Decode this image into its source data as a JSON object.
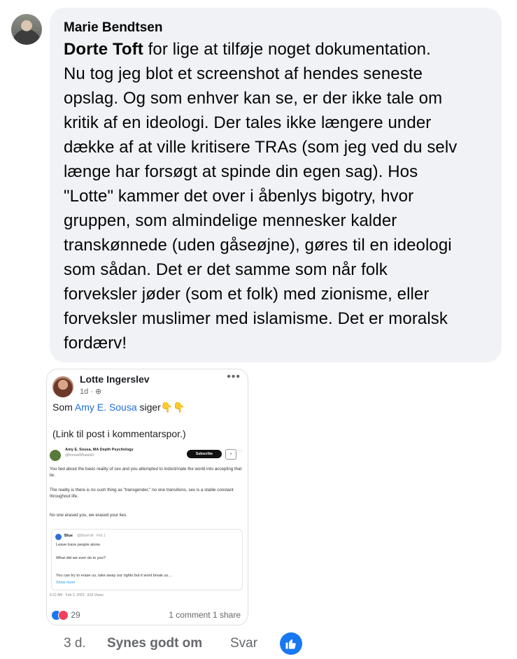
{
  "comment": {
    "author": "Marie Bendtsen",
    "mention": "Dorte Toft",
    "lines": [
      " for lige at tilføje noget dokumentation.",
      "Nu tog jeg blot et screenshot af hendes seneste",
      "opslag. Og som enhver kan se, er der ikke tale om",
      "kritik af en ideologi. Der tales ikke længere under",
      "dække af at ville kritisere TRAs (som jeg ved du selv",
      "længe har forsøgt at spinde din egen sag). Hos",
      "\"Lotte\" kammer det over i åbenlys bigotry, hvor",
      "gruppen, som almindelige mennesker kalder",
      "transkønnede (uden gåseøjne), gøres til en ideologi",
      "som sådan. Det er det samme som når folk",
      "forveksler jøder (som et folk) med zionisme, eller",
      "forveksler muslimer med islamisme. Det er moralsk",
      "fordærv!"
    ]
  },
  "screenshot": {
    "name": "Lotte Ingerslev",
    "meta": "1d · ",
    "text_pre": "Som ",
    "text_link": "Amy E. Sousa",
    "text_post": " siger👇👇",
    "text2": "(Link til post i kommentarspor.)",
    "tweet": {
      "name": "Amy E. Sousa, MA Depth Psychology",
      "handle": "@KnowsWhatsIsIt",
      "subscribe": "Subscribe",
      "p1": "You lied about the basic reality of sex and you attempted to indoctrinate the world into accepting that lie.",
      "p2": "The reality is there is no such thing as \"transgender,\" no one transitions, sex is a stable constant throughout life.",
      "p3": "No one erased you, we erased your lies.",
      "quote": {
        "name": "Blue",
        "handle": "@BlueFolf · Feb 1",
        "l1": "Leave trans people alone.",
        "l2": "What did we ever do to you?",
        "l3": "You can try to erase us, take away our rights but it wont break us....",
        "more": "Show more"
      },
      "time": "6:22 AM · Feb 3, 2025 · 829 Views"
    },
    "reactions_count": "29",
    "comments": "1 comment",
    "shares": "1 share"
  },
  "actions": {
    "time": "3 d.",
    "like": "Synes godt om",
    "reply": "Svar"
  },
  "colors": {
    "bubble": "#f0f2f5",
    "accent": "#1877f2",
    "muted": "#65676b"
  }
}
